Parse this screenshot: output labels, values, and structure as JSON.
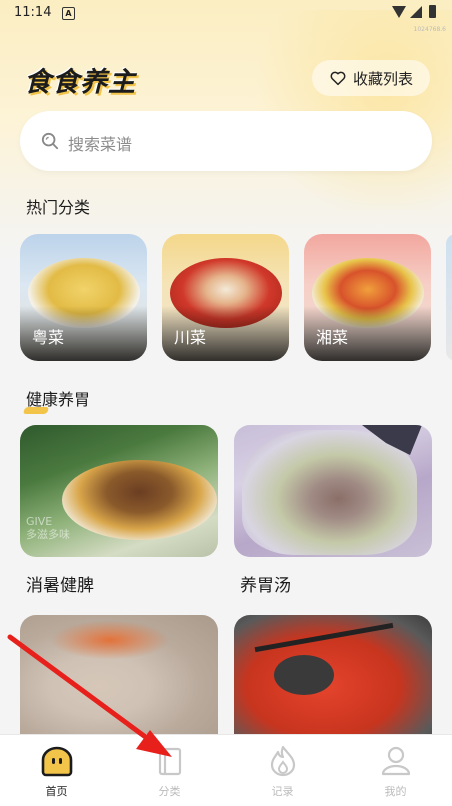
{
  "status": {
    "time": "11:14",
    "a_icon": "A",
    "tiny_text": "1024768.6"
  },
  "header": {
    "logo": "食食养主",
    "favorites_label": "收藏列表"
  },
  "search": {
    "placeholder": "搜索菜谱"
  },
  "hot": {
    "title": "热门分类",
    "items": [
      {
        "label": "粤菜",
        "color": "#e6c455"
      },
      {
        "label": "川菜",
        "color": "#d94f2b"
      },
      {
        "label": "湘菜",
        "color": "#d9582f"
      }
    ]
  },
  "health": {
    "title": "健康养胃",
    "cards": [
      {
        "name": "消暑健脾"
      },
      {
        "name": "养胃汤"
      },
      {
        "name": ""
      },
      {
        "name": ""
      }
    ],
    "watermark": "GIVE\n多滋多味"
  },
  "tabs": [
    {
      "label": "首页",
      "icon": "home-face-icon",
      "active": true
    },
    {
      "label": "分类",
      "icon": "book-icon",
      "active": false
    },
    {
      "label": "记录",
      "icon": "flame-icon",
      "active": false
    },
    {
      "label": "我的",
      "icon": "person-icon",
      "active": false
    }
  ],
  "colors": {
    "accent": "#f3c44a",
    "arrow": "#e8201c"
  }
}
